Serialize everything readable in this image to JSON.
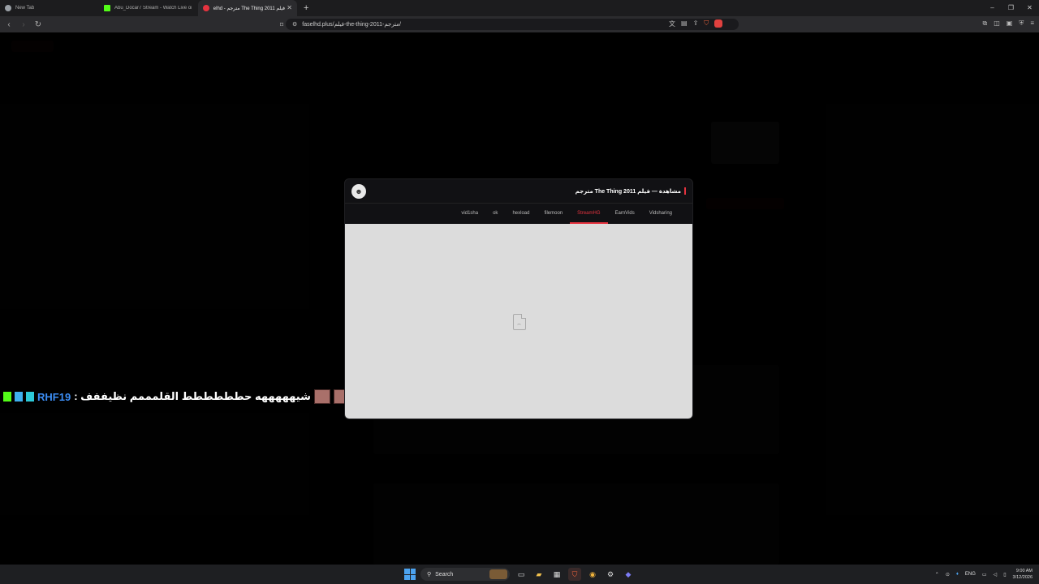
{
  "browser": {
    "tabs": [
      {
        "title": "New Tab",
        "icon": "globe-icon",
        "icon_color": "#9aa0a6"
      },
      {
        "title": "Abu_Docar7 Stream - Watch Live on",
        "icon": "kick-icon",
        "icon_color": "#53fc18"
      },
      {
        "title": "فيلم The Thing 2011 مترجم - faselhd",
        "icon": "faselhd-icon",
        "icon_color": "#e5333f"
      }
    ],
    "new_tab": "+",
    "url": "faselhd.plus/فيلم-the-thing-2011-مترجم/",
    "window_controls": {
      "minimize": "–",
      "restore": "❐",
      "close": "✕"
    }
  },
  "modal": {
    "title": "مشاهدة — فيلم The Thing 2011 مترجم",
    "servers": [
      "vid1sha",
      "ok",
      "hexload",
      "filemoon",
      "StreamHG",
      "EarnVids",
      "Vidsharing"
    ],
    "active_server": "StreamHG",
    "accent": "#e5333f"
  },
  "chat": {
    "username": "RHF19",
    "message": ": شيهههههه حطططططط القلمممم نظيففف"
  },
  "taskbar": {
    "search": "Search",
    "lang": "ENG",
    "time": "9:00 AM",
    "date": "3/12/2026"
  }
}
